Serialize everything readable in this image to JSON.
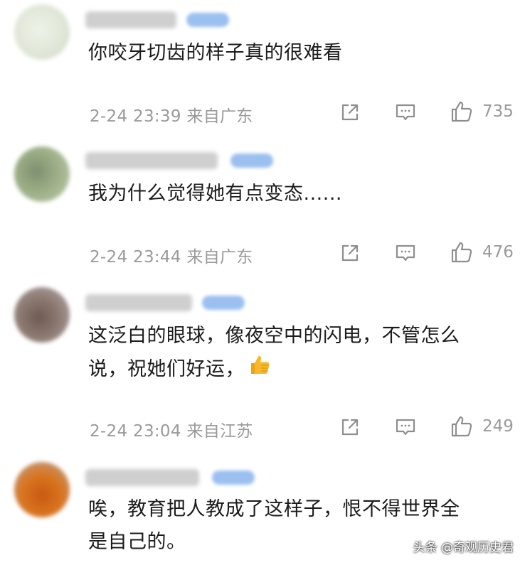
{
  "comments": [
    {
      "text": "你咬牙切齿的样子真的很难看",
      "time_location": "2-24 23:39 来自广东",
      "likes": "735"
    },
    {
      "text": "我为什么觉得她有点变态......",
      "time_location": "2-24 23:44 来自广东",
      "likes": "476"
    },
    {
      "text_line1": "这泛白的眼球，像夜空中的闪电，不管怎么",
      "text_line2": "说，祝她们好运，",
      "time_location": "2-24 23:04 来自江苏",
      "likes": "249"
    },
    {
      "text_line1": "唉，教育把人教成了这样子，恨不得世界全",
      "text_line2": "是自己的。"
    }
  ],
  "watermark": "头条 @奇观历史君",
  "colors": {
    "text": "#1b1b1b",
    "meta": "#9a9a9a",
    "badge": "#9bc0f0",
    "icon": "#8e8e8e"
  },
  "icons": {
    "share": "share-icon",
    "reply": "comment-icon",
    "like": "thumbs-up-icon",
    "emoji": "thumbs-up-emoji"
  }
}
